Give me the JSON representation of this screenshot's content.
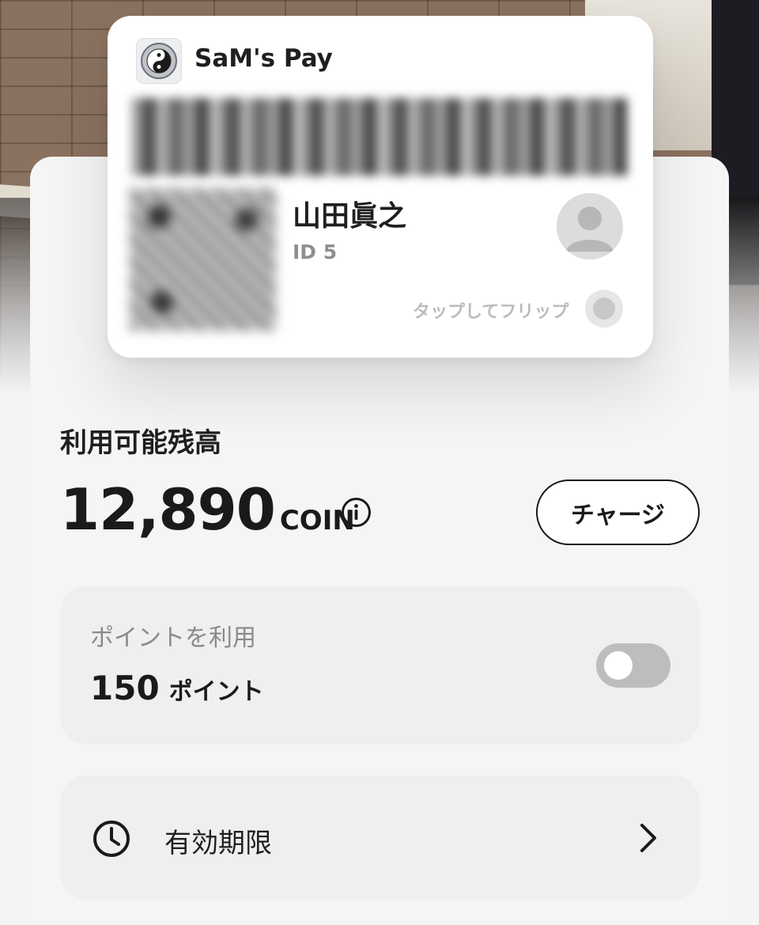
{
  "card": {
    "app_name": "SaM's Pay",
    "holder_name": "山田眞之",
    "holder_id": "ID 5",
    "flip_hint": "タップしてフリップ"
  },
  "balance": {
    "label": "利用可能残高",
    "amount": "12,890",
    "unit": "COIN",
    "charge_label": "チャージ"
  },
  "points": {
    "title": "ポイントを利用",
    "value": "150",
    "unit": "ポイント",
    "toggle_on": false
  },
  "expiry": {
    "label": "有効期限"
  },
  "icons": {
    "logo": "yin-yang-logo-icon",
    "avatar": "user-avatar-icon",
    "info": "info-icon",
    "clock": "clock-icon",
    "chevron": "chevron-right-icon"
  }
}
